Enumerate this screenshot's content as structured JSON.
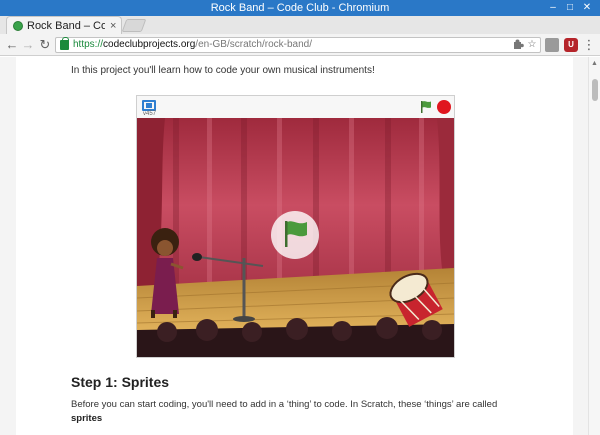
{
  "window": {
    "title": "Rock Band – Code Club - Chromium",
    "minimize_glyph": "–",
    "maximize_glyph": "□",
    "close_glyph": "✕"
  },
  "tab": {
    "title": "Rock Band – Code",
    "close_glyph": "×"
  },
  "toolbar": {
    "back_glyph": "←",
    "forward_glyph": "→",
    "reload_glyph": "↻",
    "url_scheme": "https://",
    "url_host": "codeclubprojects.org",
    "url_path": "/en-GB/scratch/rock-band/",
    "star_glyph": "☆",
    "menu_glyph": "⋮",
    "ublock_label": "U"
  },
  "page": {
    "intro": "In this project you'll learn how to code your own musical instruments!",
    "player": {
      "version": "v457"
    },
    "step_heading": "Step 1: Sprites",
    "step_text": "Before you can start coding, you'll need to add in a ‘thing’ to code. In Scratch, these ‘things’ are called",
    "step_text_bold": "sprites"
  },
  "colors": {
    "titlebar": "#2a78c7",
    "curtain": "#c23a4f",
    "stage_floor": "#d9a94e",
    "flag_green": "#4b9a3c",
    "stop_red": "#e0161f"
  }
}
